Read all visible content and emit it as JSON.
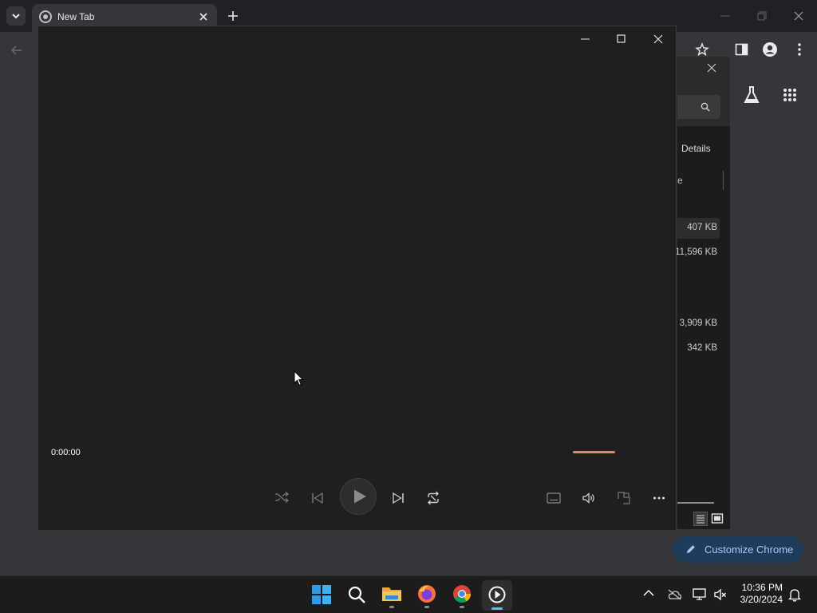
{
  "browser": {
    "tab_title": "New Tab",
    "customize_label": "Customize Chrome"
  },
  "explorer": {
    "details_label": "Details",
    "column_header_fragment": "e",
    "sizes": [
      "407 KB",
      "11,596 KB",
      "3,909 KB",
      "342 KB"
    ]
  },
  "player": {
    "current_time": "0:00:00",
    "progress": 0.0
  },
  "taskbar": {
    "time": "10:36 PM",
    "date": "3/20/2024",
    "apps": [
      "start-icon",
      "search-icon",
      "file-explorer-icon",
      "firefox-icon",
      "chrome-icon",
      "media-player-icon"
    ]
  },
  "colors": {
    "accent": "#e8875a",
    "chrome_blue": "#a8c7fa",
    "taskbar_active": "#4cc2ff"
  }
}
